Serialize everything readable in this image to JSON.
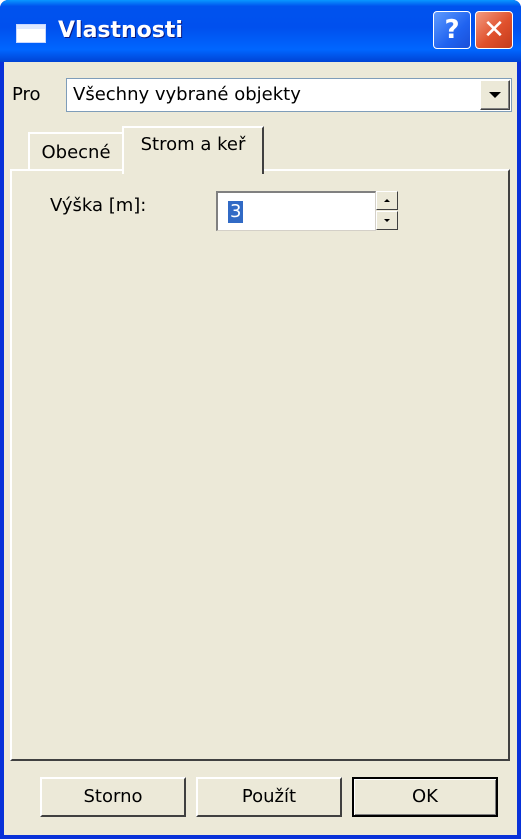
{
  "window": {
    "title": "Vlastnosti",
    "help_glyph": "?",
    "close_glyph": "✕"
  },
  "pro": {
    "label": "Pro",
    "selected": "Všechny vybrané objekty"
  },
  "tabs": [
    {
      "label": "Obecné",
      "active": false
    },
    {
      "label": "Strom a keř",
      "active": true
    }
  ],
  "panel": {
    "height_label": "Výška [m]:",
    "height_value": "3"
  },
  "buttons": {
    "cancel": "Storno",
    "apply": "Použít",
    "ok": "OK"
  },
  "colors": {
    "titlebar": "#0054e3",
    "face": "#ece9d8",
    "close": "#e0512d",
    "selection": "#316ac5"
  },
  "icons": [
    "window-icon",
    "help-icon",
    "close-icon",
    "chevron-down-icon",
    "spin-up-icon",
    "spin-down-icon"
  ]
}
